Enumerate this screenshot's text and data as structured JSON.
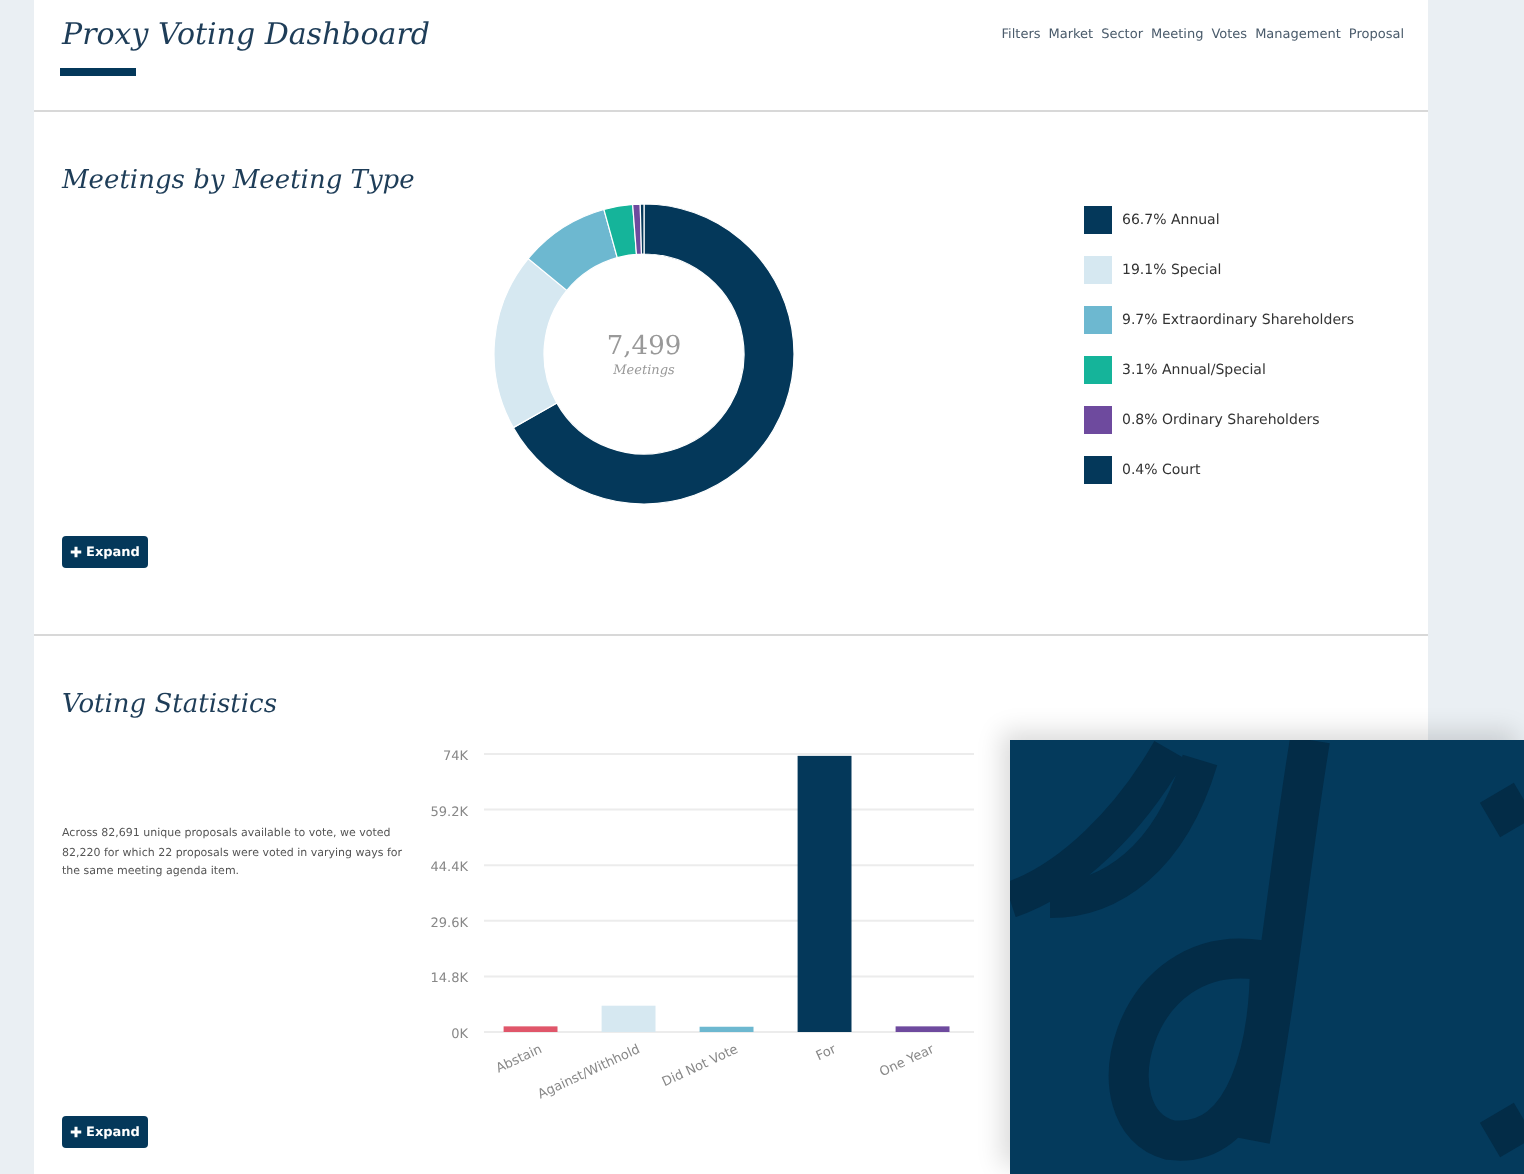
{
  "header": {
    "title": "Proxy Voting Dashboard",
    "nav": [
      "Filters",
      "Market",
      "Sector",
      "Meeting",
      "Votes",
      "Management",
      "Proposal"
    ]
  },
  "meetings_section": {
    "title": "Meetings by Meeting Type",
    "center_value": "7,499",
    "center_label": "Meetings",
    "expand_button": "Expand",
    "legend": [
      {
        "color": "#04385a"
      },
      {
        "color": "#d6e8f1"
      },
      {
        "color": "#6db8d0"
      },
      {
        "color": "#15b49a"
      },
      {
        "color": "#6e4a9e"
      },
      {
        "color": "#04385a"
      }
    ],
    "chart_data": {
      "type": "donut",
      "categories": [
        "66.7% Annual",
        "19.1% Special",
        "9.7% Extraordinary Shareholders",
        "3.1% Annual/Special",
        "0.8% Ordinary Shareholders",
        "0.4% Court"
      ],
      "values": [
        66.7,
        19.1,
        9.7,
        3.1,
        0.8,
        0.4
      ]
    }
  },
  "voting_section": {
    "title": "Voting Statistics",
    "description": "Across 82,691 unique proposals available to vote, we voted 82,220 for which 22 proposals were voted in varying ways for the same meeting agenda item.",
    "expand_button": "Expand",
    "chart_data": {
      "type": "bar",
      "grid": true,
      "series": [
        {
          "name": "Abstain",
          "color": "#e0566a",
          "values": [
            1500,
            null,
            null,
            null,
            null
          ]
        },
        {
          "name": "Against/Withhold",
          "color": "#d6e8f1",
          "values": [
            null,
            7000,
            null,
            null,
            null
          ]
        },
        {
          "name": "Did Not Vote",
          "color": "#6db8d0",
          "values": [
            null,
            null,
            1400,
            null,
            null
          ]
        },
        {
          "name": "For",
          "color": "#04385a",
          "values": [
            null,
            null,
            null,
            73500,
            null
          ]
        },
        {
          "name": "One Year",
          "color": "#6e4a9e",
          "values": [
            null,
            null,
            null,
            null,
            1500
          ]
        }
      ],
      "ylim": [
        0,
        74000
      ],
      "yticks": [
        {
          "value": 0,
          "label": "0K"
        },
        {
          "value": 14800,
          "label": "14.8K"
        },
        {
          "value": 29600,
          "label": "29.6K"
        },
        {
          "value": 44400,
          "label": "44.4K"
        },
        {
          "value": 59200,
          "label": "59.2K"
        },
        {
          "value": 74000,
          "label": "74K"
        }
      ]
    }
  }
}
